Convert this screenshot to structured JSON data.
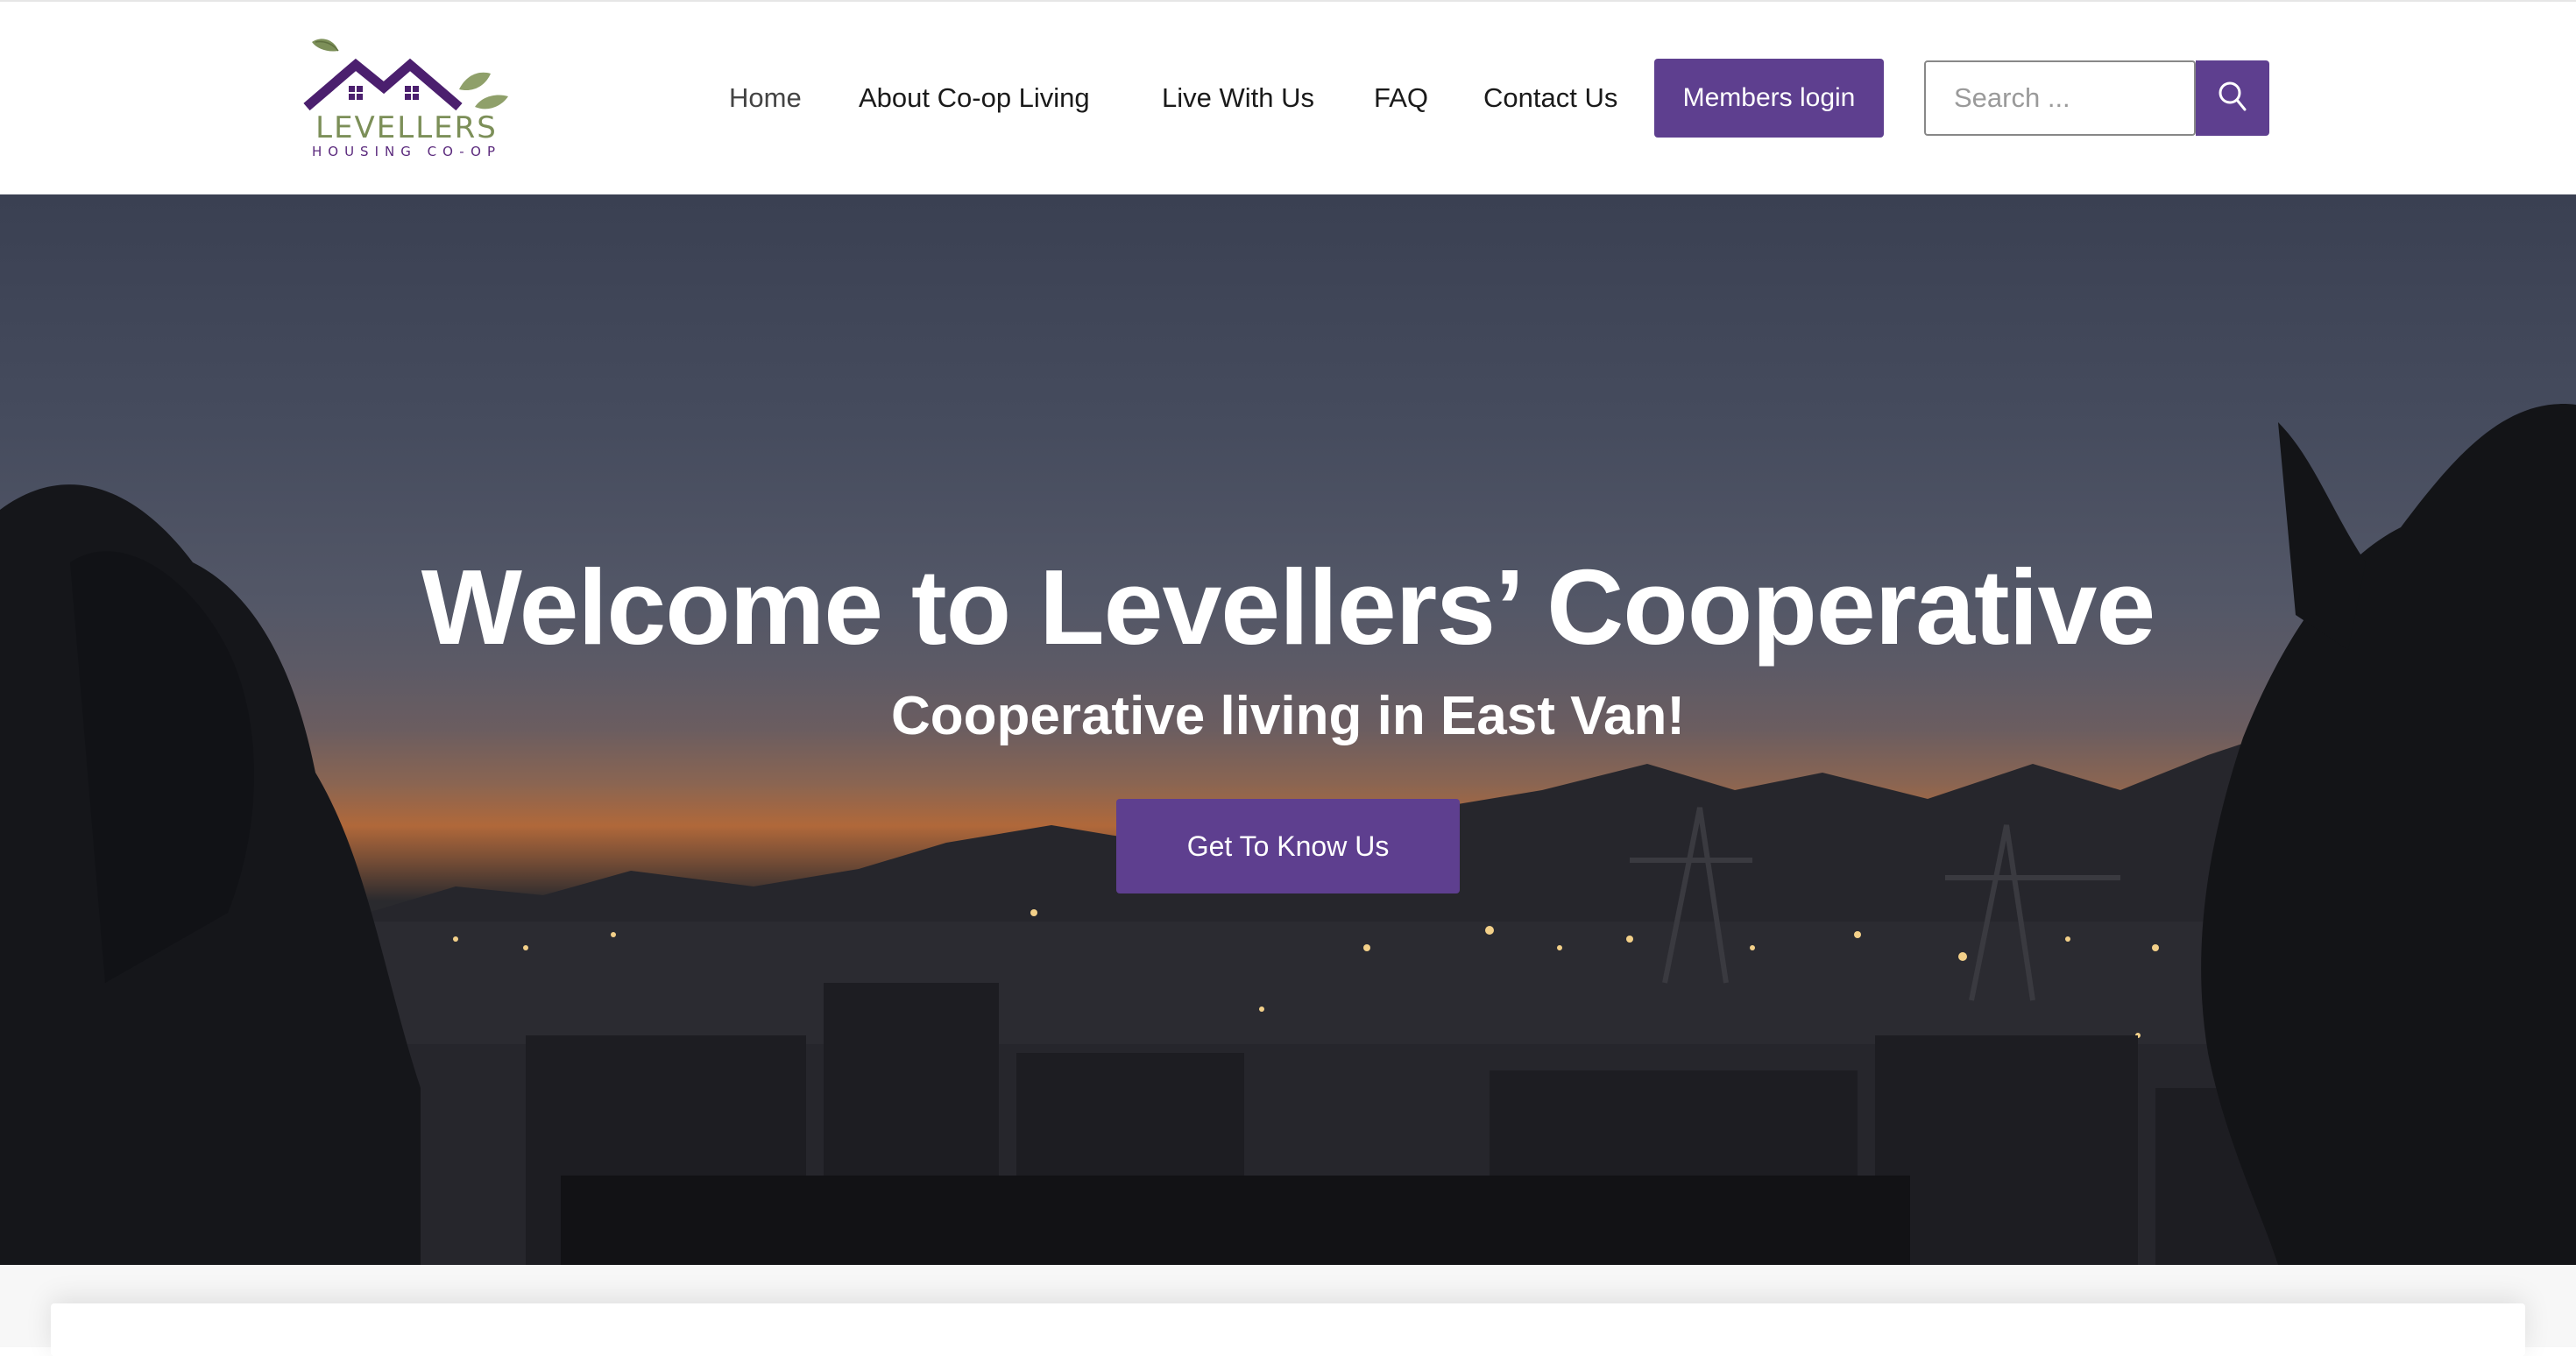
{
  "brand": {
    "name": "LEVELLERS",
    "tagline": "HOUSING CO-OP",
    "colors": {
      "purple": "#5e3f8f",
      "green": "#7c8f58"
    }
  },
  "nav": {
    "items": [
      {
        "label": "Home",
        "active": true
      },
      {
        "label": "About Co-op Living",
        "active": false
      },
      {
        "label": "Live With Us",
        "active": false
      },
      {
        "label": "FAQ",
        "active": false
      },
      {
        "label": "Contact Us",
        "active": false
      }
    ],
    "login_label": "Members login"
  },
  "search": {
    "placeholder": "Search ...",
    "icon": "search-icon"
  },
  "hero": {
    "title": "Welcome to Levellers’ Cooperative",
    "subtitle": "Cooperative living in East Van!",
    "cta_label": "Get To Know Us"
  }
}
